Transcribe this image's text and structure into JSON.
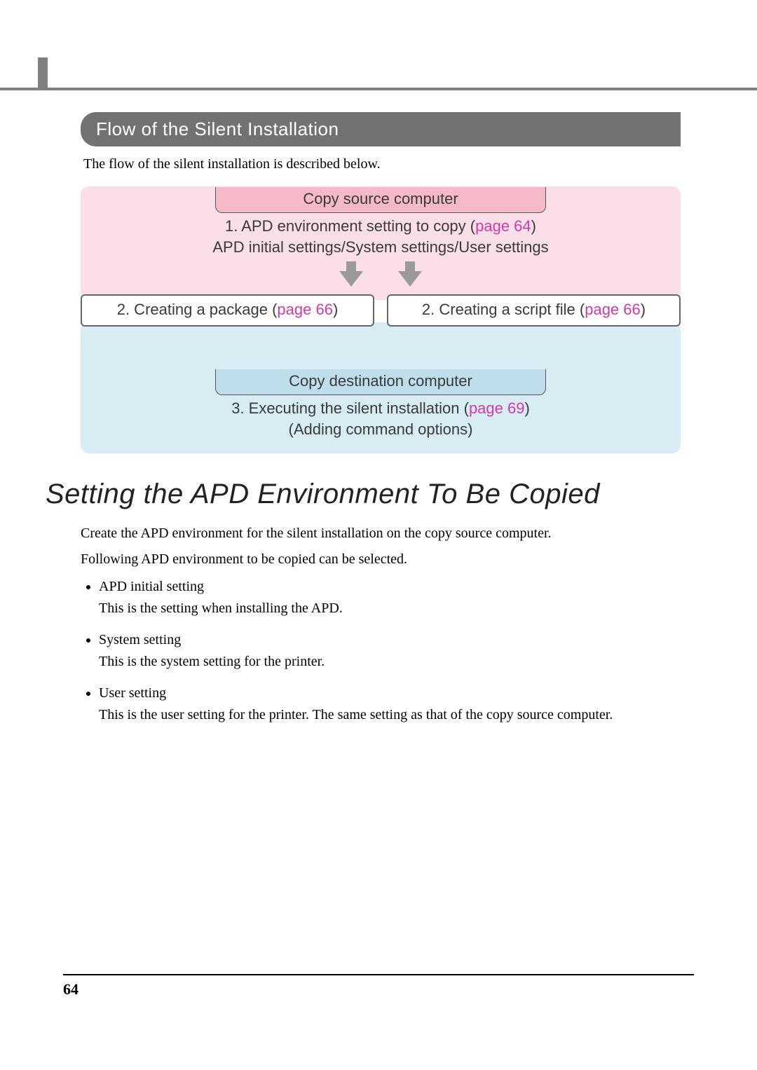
{
  "section_heading": "Flow of the Silent Installation",
  "intro": "The flow of the silent installation is described below.",
  "diagram": {
    "source": {
      "title": "Copy source computer",
      "step1_prefix": "1. APD environment setting to copy (",
      "step1_link": "page 64",
      "step1_suffix": ")",
      "step1_sub": "APD initial settings/System settings/User settings"
    },
    "package": {
      "prefix": "2. Creating a package (",
      "link": "page 66",
      "suffix": ")"
    },
    "script": {
      "prefix": "2. Creating a script file (",
      "link": "page 66",
      "suffix": ")"
    },
    "dest": {
      "title": "Copy destination computer",
      "step3_prefix": "3. Executing the silent installation (",
      "step3_link": "page 69",
      "step3_suffix": ")",
      "step3_sub": "(Adding command options)"
    }
  },
  "h2": "Setting the APD Environment To Be Copied",
  "para1": "Create the APD environment for the silent installation on the copy source computer.",
  "para2": "Following APD environment to be copied can be selected.",
  "bullets": [
    {
      "title": "APD initial setting",
      "desc": "This is the setting when installing the APD."
    },
    {
      "title": "System setting",
      "desc": "This is the system setting for the printer."
    },
    {
      "title": "User setting",
      "desc": "This is the user setting for the printer. The same setting as that of the copy source computer."
    }
  ],
  "page_number": "64"
}
